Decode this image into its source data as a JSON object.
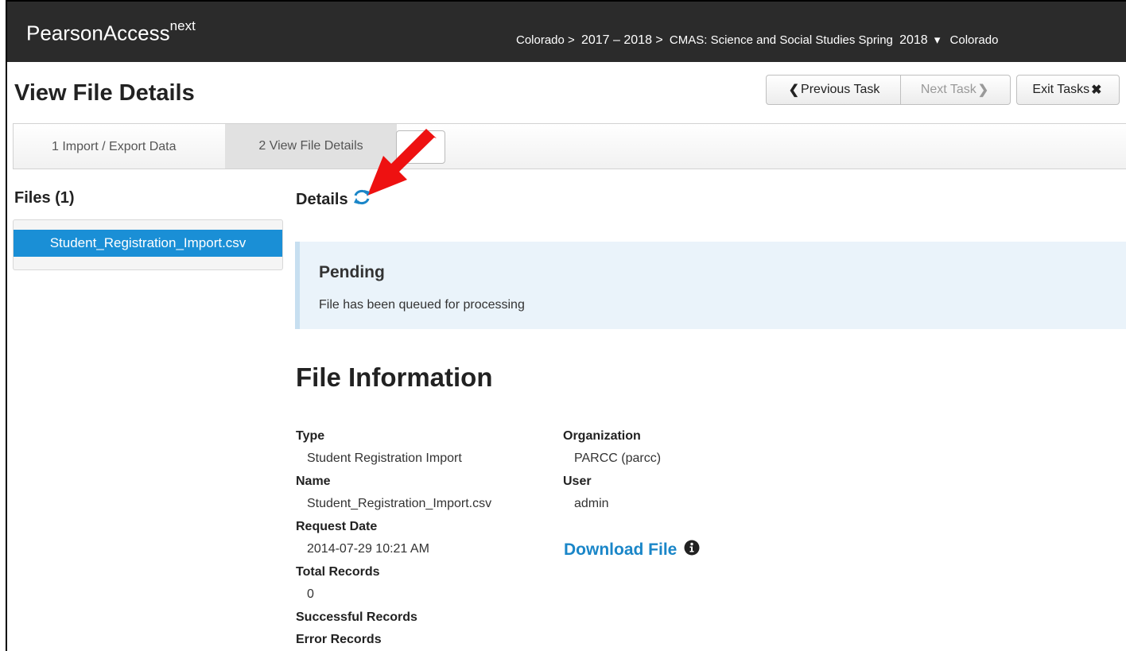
{
  "header": {
    "brand": "PearsonAccess",
    "brand_sup": "next",
    "breadcrumb": {
      "state": "Colorado >",
      "year": "2017 – 2018 >",
      "test": "CMAS: Science and Social Studies Spring",
      "test_year": "2018",
      "dropdown": "▾",
      "org": "Colorado"
    }
  },
  "page": {
    "title": "View File Details",
    "buttons": {
      "previous": "Previous Task",
      "next": "Next Task",
      "exit": "Exit Tasks"
    }
  },
  "steps": [
    {
      "label": "1 Import / Export Data"
    },
    {
      "label": "2 View File Details"
    }
  ],
  "files": {
    "title": "Files (1)",
    "items": [
      {
        "name": "Student_Registration_Import.csv"
      }
    ]
  },
  "details": {
    "title": "Details",
    "alert": {
      "title": "Pending",
      "message": "File has been queued for processing"
    }
  },
  "file_info": {
    "title": "File Information",
    "type_label": "Type",
    "type_value": "Student Registration Import",
    "name_label": "Name",
    "name_value": "Student_Registration_Import.csv",
    "date_label": "Request Date",
    "date_value": "2014-07-29 10:21 AM",
    "total_label": "Total Records",
    "total_value": "0",
    "success_label": "Successful Records",
    "error_label": "Error Records",
    "org_label": "Organization",
    "org_value": "PARCC (parcc)",
    "user_label": "User",
    "user_value": "admin",
    "download": "Download File"
  },
  "colors": {
    "header_bg": "#2b2b2b",
    "accent": "#1a8fd6",
    "alert_bg": "#eaf3fa",
    "annotation_arrow": "#ee1111"
  }
}
